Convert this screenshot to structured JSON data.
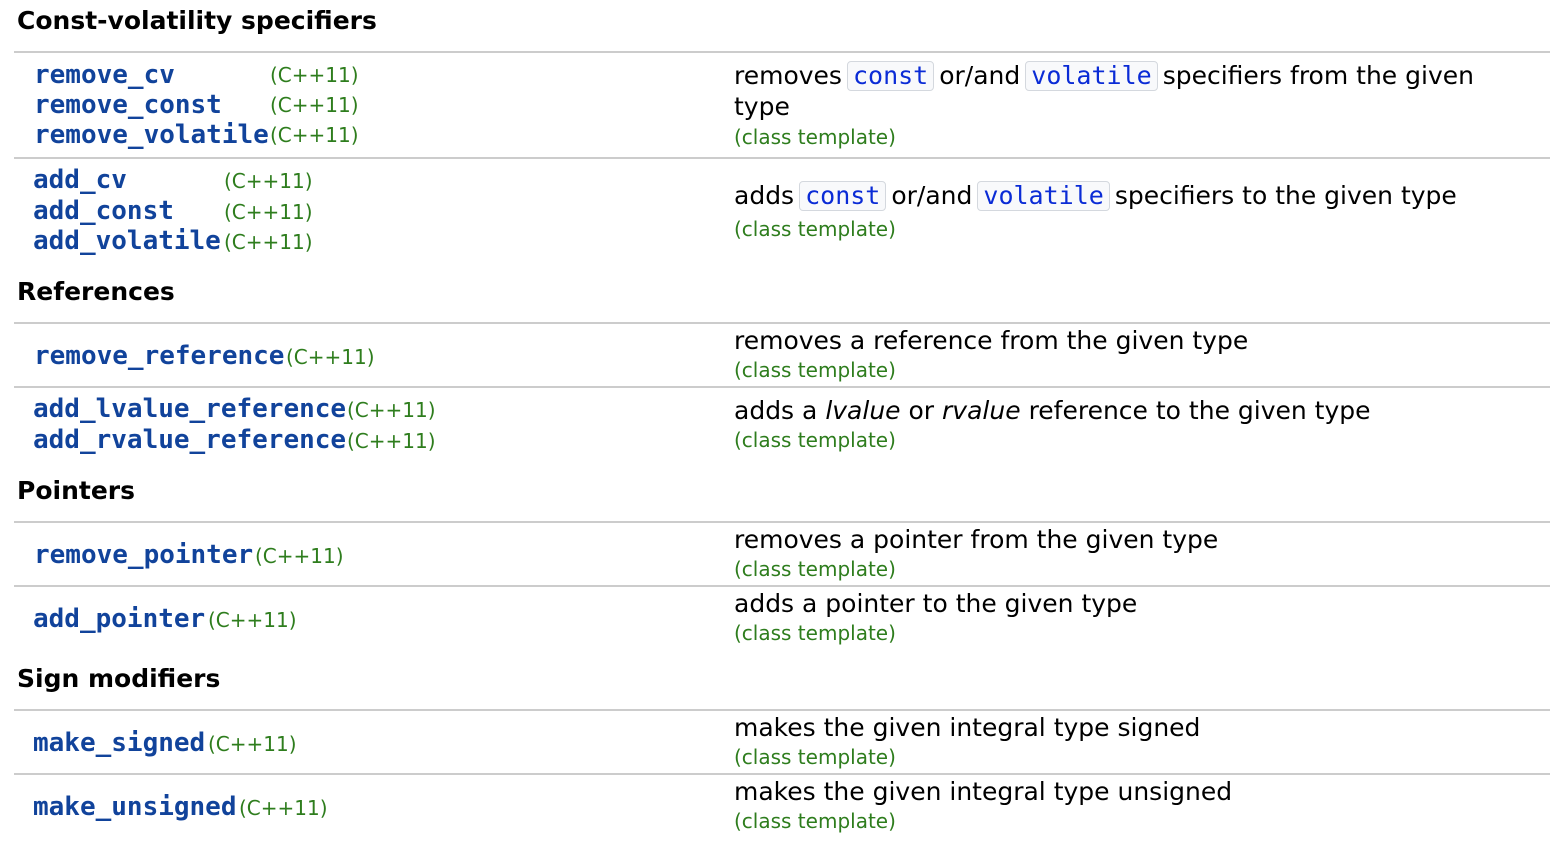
{
  "sections": [
    {
      "title": "Const-volatility specifiers"
    },
    {
      "title": "References"
    },
    {
      "title": "Pointers"
    },
    {
      "title": "Sign modifiers"
    }
  ],
  "rows": [
    {
      "names": [
        "remove_cv",
        "remove_const",
        "remove_volatile"
      ],
      "version": "(C++11)",
      "desc": {
        "pre": "removes",
        "kw1": "const",
        "mid": "or/and",
        "kw2": "volatile",
        "post": "specifiers from the given type"
      },
      "tag": "(class template)"
    },
    {
      "names": [
        "add_cv",
        "add_const",
        "add_volatile"
      ],
      "version": "(C++11)",
      "desc": {
        "pre": "adds",
        "kw1": "const",
        "mid": "or/and",
        "kw2": "volatile",
        "post": "specifiers to the given type"
      },
      "tag": "(class template)"
    },
    {
      "names": [
        "remove_reference"
      ],
      "version": "(C++11)",
      "desc": {
        "text": "removes a reference from the given type"
      },
      "tag": "(class template)"
    },
    {
      "names": [
        "add_lvalue_reference",
        "add_rvalue_reference"
      ],
      "version": "(C++11)",
      "desc": {
        "pre": "adds a",
        "em1": "lvalue",
        "mid": "or",
        "em2": "rvalue",
        "post": "reference to the given type"
      },
      "tag": "(class template)"
    },
    {
      "names": [
        "remove_pointer"
      ],
      "version": "(C++11)",
      "desc": {
        "text": "removes a pointer from the given type"
      },
      "tag": "(class template)"
    },
    {
      "names": [
        "add_pointer"
      ],
      "version": "(C++11)",
      "desc": {
        "text": "adds a pointer to the given type"
      },
      "tag": "(class template)"
    },
    {
      "names": [
        "make_signed"
      ],
      "version": "(C++11)",
      "desc": {
        "text": "makes the given integral type signed"
      },
      "tag": "(class template)"
    },
    {
      "names": [
        "make_unsigned"
      ],
      "version": "(C++11)",
      "desc": {
        "text": "makes the given integral type unsigned"
      },
      "tag": "(class template)"
    }
  ]
}
